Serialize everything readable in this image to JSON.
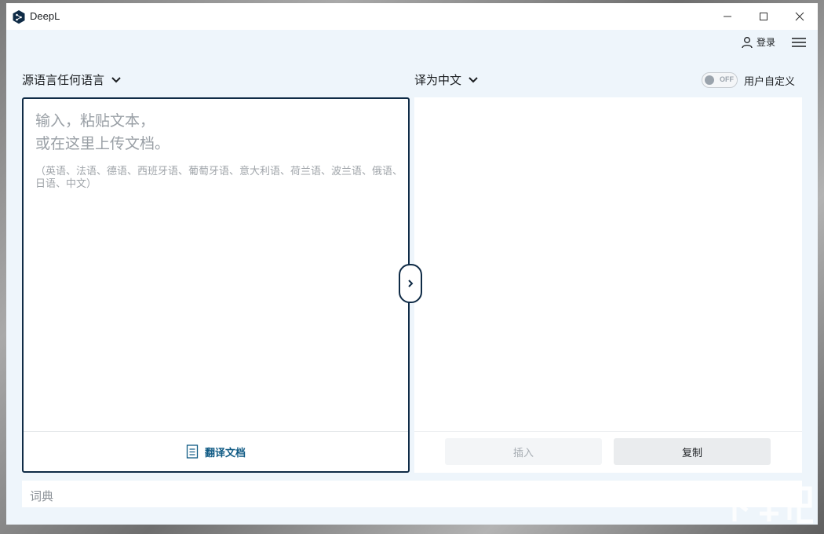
{
  "window": {
    "app_title": "DeepL"
  },
  "topbar": {
    "login_label": "登录"
  },
  "source": {
    "language_label": "源语言任何语言",
    "placeholder_line1": "输入，粘贴文本，",
    "placeholder_line2": "或在这里上传文档。",
    "supported_languages_hint": "（英语、法语、德语、西班牙语、葡萄牙语、意大利语、荷兰语、波兰语、俄语、日语、中文）",
    "translate_document_label": "翻译文档"
  },
  "target": {
    "language_label": "译为中文",
    "glossary_toggle_state": "OFF",
    "glossary_toggle_label": "用户自定义",
    "insert_label": "插入",
    "copy_label": "复制"
  },
  "dictionary": {
    "label": "词典"
  },
  "colors": {
    "accent": "#0f2b46",
    "link": "#0f5a84",
    "panel_bg": "#eef5fb"
  }
}
